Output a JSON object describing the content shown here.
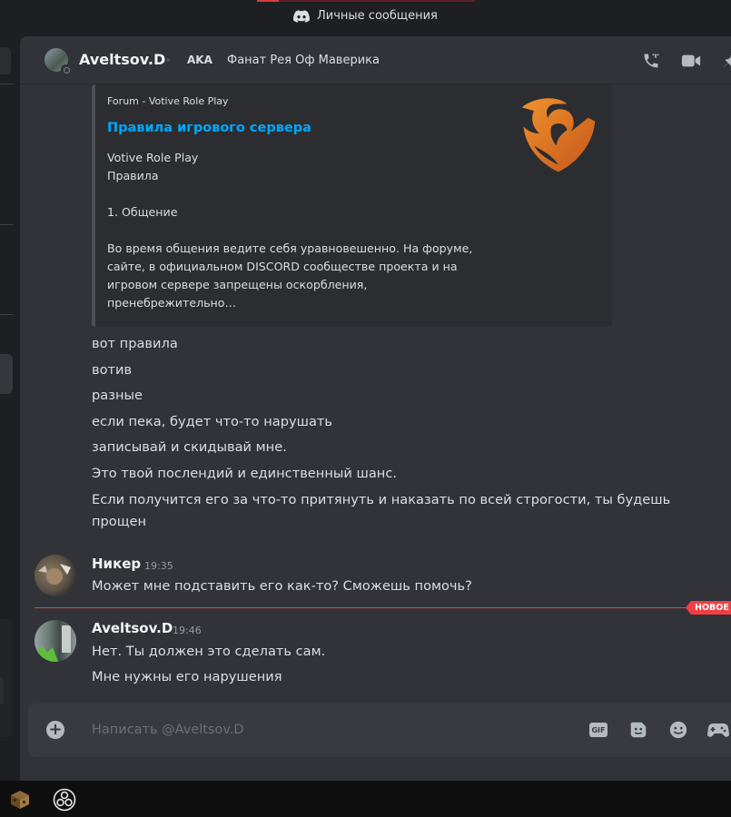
{
  "window": {
    "title": "Личные сообщения"
  },
  "header": {
    "username": "Aveltsov.D",
    "aka_label": "AKA",
    "aka_value": "Фанат Рея Оф Маверика"
  },
  "embed": {
    "provider": "Forum - Votive Role Play",
    "title": "Правила игрового сервера",
    "description": "Votive Role Play\nПравила\n\n1. Общение\n\nВо время общения ведите себя уравновешенно. На форуме, сайте, в официальном DISCORD сообществе проекта и на игровом сервере запрещены оскорбления, пренебрежительно…",
    "accent": "#e87722"
  },
  "messages": {
    "group1": {
      "lines": [
        "вот правила",
        "вотив",
        "разные",
        "если пека, будет что-то нарушать",
        "записывай и скидывай мне.",
        "Это твой послендий и единственный шанс.",
        "Если получится его за что-то притянуть и наказать по всей строгости, ты будешь",
        "прощен"
      ]
    },
    "group2": {
      "author": "Никер",
      "time": "19:35",
      "lines": [
        "Может мне подставить его как-то? Сможешь помочь?"
      ]
    },
    "new_badge": "НОВОЕ",
    "group3": {
      "author": "Aveltsov.D",
      "time": "19:46",
      "lines": [
        "Нет. Ты должен это сделать сам.",
        "Мне нужны его нарушения"
      ]
    }
  },
  "composer": {
    "placeholder": "Написать @Aveltsov.D",
    "gif_label": "GIF"
  },
  "icons": {
    "header": [
      "phone-call-icon",
      "video-call-icon",
      "pin-icon"
    ],
    "composer": [
      "gif-icon",
      "sticker-icon",
      "emoji-icon",
      "activity-icon"
    ],
    "taskbar": [
      "minecraft-app-icon",
      "obs-app-icon"
    ]
  },
  "colors": {
    "link": "#00a8fc",
    "new_divider": "#f23f43",
    "background": "#313338"
  }
}
